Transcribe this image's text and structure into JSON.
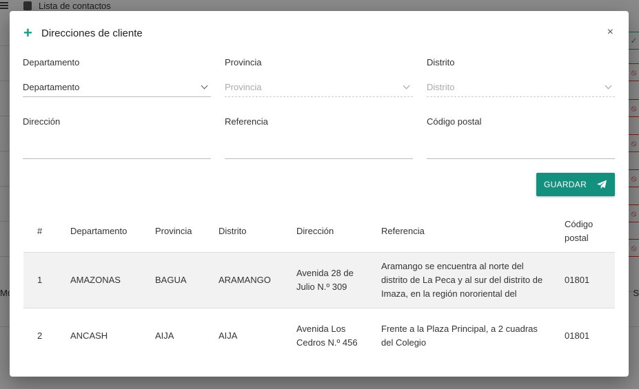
{
  "background": {
    "page_title": "Lista de contactos",
    "left_text": "Mo",
    "right_text": "S"
  },
  "dialog": {
    "title": "Direcciones de cliente",
    "close_label": "×",
    "fields": {
      "departamento": {
        "label": "Departamento",
        "value": "Departamento"
      },
      "provincia": {
        "label": "Provincia",
        "placeholder": "Provincia"
      },
      "distrito": {
        "label": "Distrito",
        "placeholder": "Distrito"
      },
      "direccion": {
        "label": "Dirección",
        "value": ""
      },
      "referencia": {
        "label": "Referencia",
        "value": ""
      },
      "codigo_postal": {
        "label": "Código postal",
        "value": ""
      }
    },
    "save_label": "GUARDAR",
    "accent_color": "#14907f"
  },
  "table": {
    "headers": [
      "#",
      "Departamento",
      "Provincia",
      "Distrito",
      "Dirección",
      "Referencia",
      "Código postal"
    ],
    "rows": [
      {
        "n": "1",
        "departamento": "AMAZONAS",
        "provincia": "BAGUA",
        "distrito": "ARAMANGO",
        "direccion": "Avenida 28 de Julio N.º 309",
        "referencia": "Aramango se encuentra al norte del distrito de La Peca y al sur del distrito de Imaza, en la región nororiental del",
        "codigo_postal": "01801"
      },
      {
        "n": "2",
        "departamento": "ANCASH",
        "provincia": "AIJA",
        "distrito": "AIJA",
        "direccion": "Avenida Los Cedros N.º 456",
        "referencia": "Frente a la Plaza Principal, a 2 cuadras del Colegio",
        "codigo_postal": "01801"
      }
    ]
  }
}
